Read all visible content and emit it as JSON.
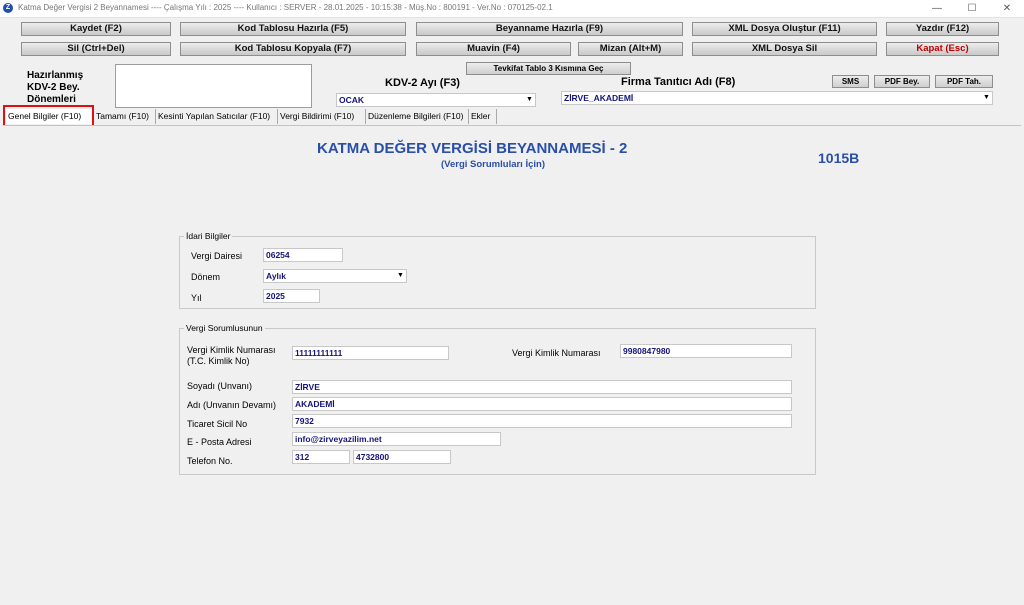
{
  "window": {
    "title": "Katma Değer Vergisi 2 Beyannamesi  ----  Çalışma Yılı : 2025  ----  Kullanıcı : SERVER - 28.01.2025 - 10:15:38 - Müş.No : 800191 - Ver.No : 070125-02.1",
    "app_icon": "Z",
    "minimize": "—",
    "maximize": "☐",
    "close": "✕"
  },
  "toolbar": {
    "row1": [
      "Kaydet (F2)",
      "Kod Tablosu Hazırla (F5)",
      "Beyanname Hazırla (F9)",
      "XML Dosya Oluştur (F11)",
      "Yazdır (F12)"
    ],
    "row2": [
      "Sil (Ctrl+Del)",
      "Kod Tablosu Kopyala (F7)",
      "Muavin (F4)",
      "Mizan (Alt+M)",
      "XML Dosya Sil",
      "Kapat (Esc)"
    ],
    "tevkifat": "Tevkifat Tablo 3 Kısmına Geç",
    "sms": "SMS",
    "pdf_bey": "PDF Bey.",
    "pdf_tah": "PDF Tah."
  },
  "top": {
    "hazirlanmis_label": "Hazırlanmış KDV-2 Bey. Dönemleri",
    "kdv_ay_label": "KDV-2 Ayı (F3)",
    "kdv_ay_value": "OCAK",
    "firma_label": "Firma Tanıtıcı Adı (F8)",
    "firma_value": "ZİRVE_AKADEMİ"
  },
  "tabs": [
    "Genel Bilgiler (F10)",
    "Tamamı (F10)",
    "Kesinti Yapılan Satıcılar (F10)",
    "Vergi Bildirimi (F10)",
    "Düzenleme Bilgileri (F10)",
    "Ekler"
  ],
  "header": {
    "title": "KATMA  DEĞER VERGİSİ BEYANNAMESİ - 2",
    "subtitle": "(Vergi Sorumluları İçin)",
    "code": "1015B"
  },
  "idari": {
    "group_title": "İdari Bilgiler",
    "vergi_dairesi_label": "Vergi Dairesi",
    "vergi_dairesi_value": "06254",
    "donem_label": "Dönem",
    "donem_value": "Aylık",
    "yil_label": "Yıl",
    "yil_value": "2025"
  },
  "sorumlu": {
    "group_title": "Vergi Sorumlusunun",
    "tckn_label": "Vergi Kimlik Numarası (T.C. Kimlik No)",
    "tckn_value": "11111111111",
    "vkn_label": "Vergi Kimlik Numarası",
    "vkn_value": "9980847980",
    "soyadi_label": "Soyadı (Unvanı)",
    "soyadi_value": "ZİRVE",
    "adi_label": "Adı (Unvanın Devamı)",
    "adi_value": "AKADEMİ",
    "ticaret_label": "Ticaret Sicil No",
    "ticaret_value": "7932",
    "eposta_label": "E - Posta Adresi",
    "eposta_value": "info@zirveyazilim.net",
    "telefon_label": "Telefon No.",
    "telefon_kod": "312",
    "telefon_no": "4732800"
  },
  "colors": {
    "header_blue": "#2a4fa8",
    "highlight": "#e01010",
    "close_red": "#c00000",
    "field_text": "#14147a"
  }
}
